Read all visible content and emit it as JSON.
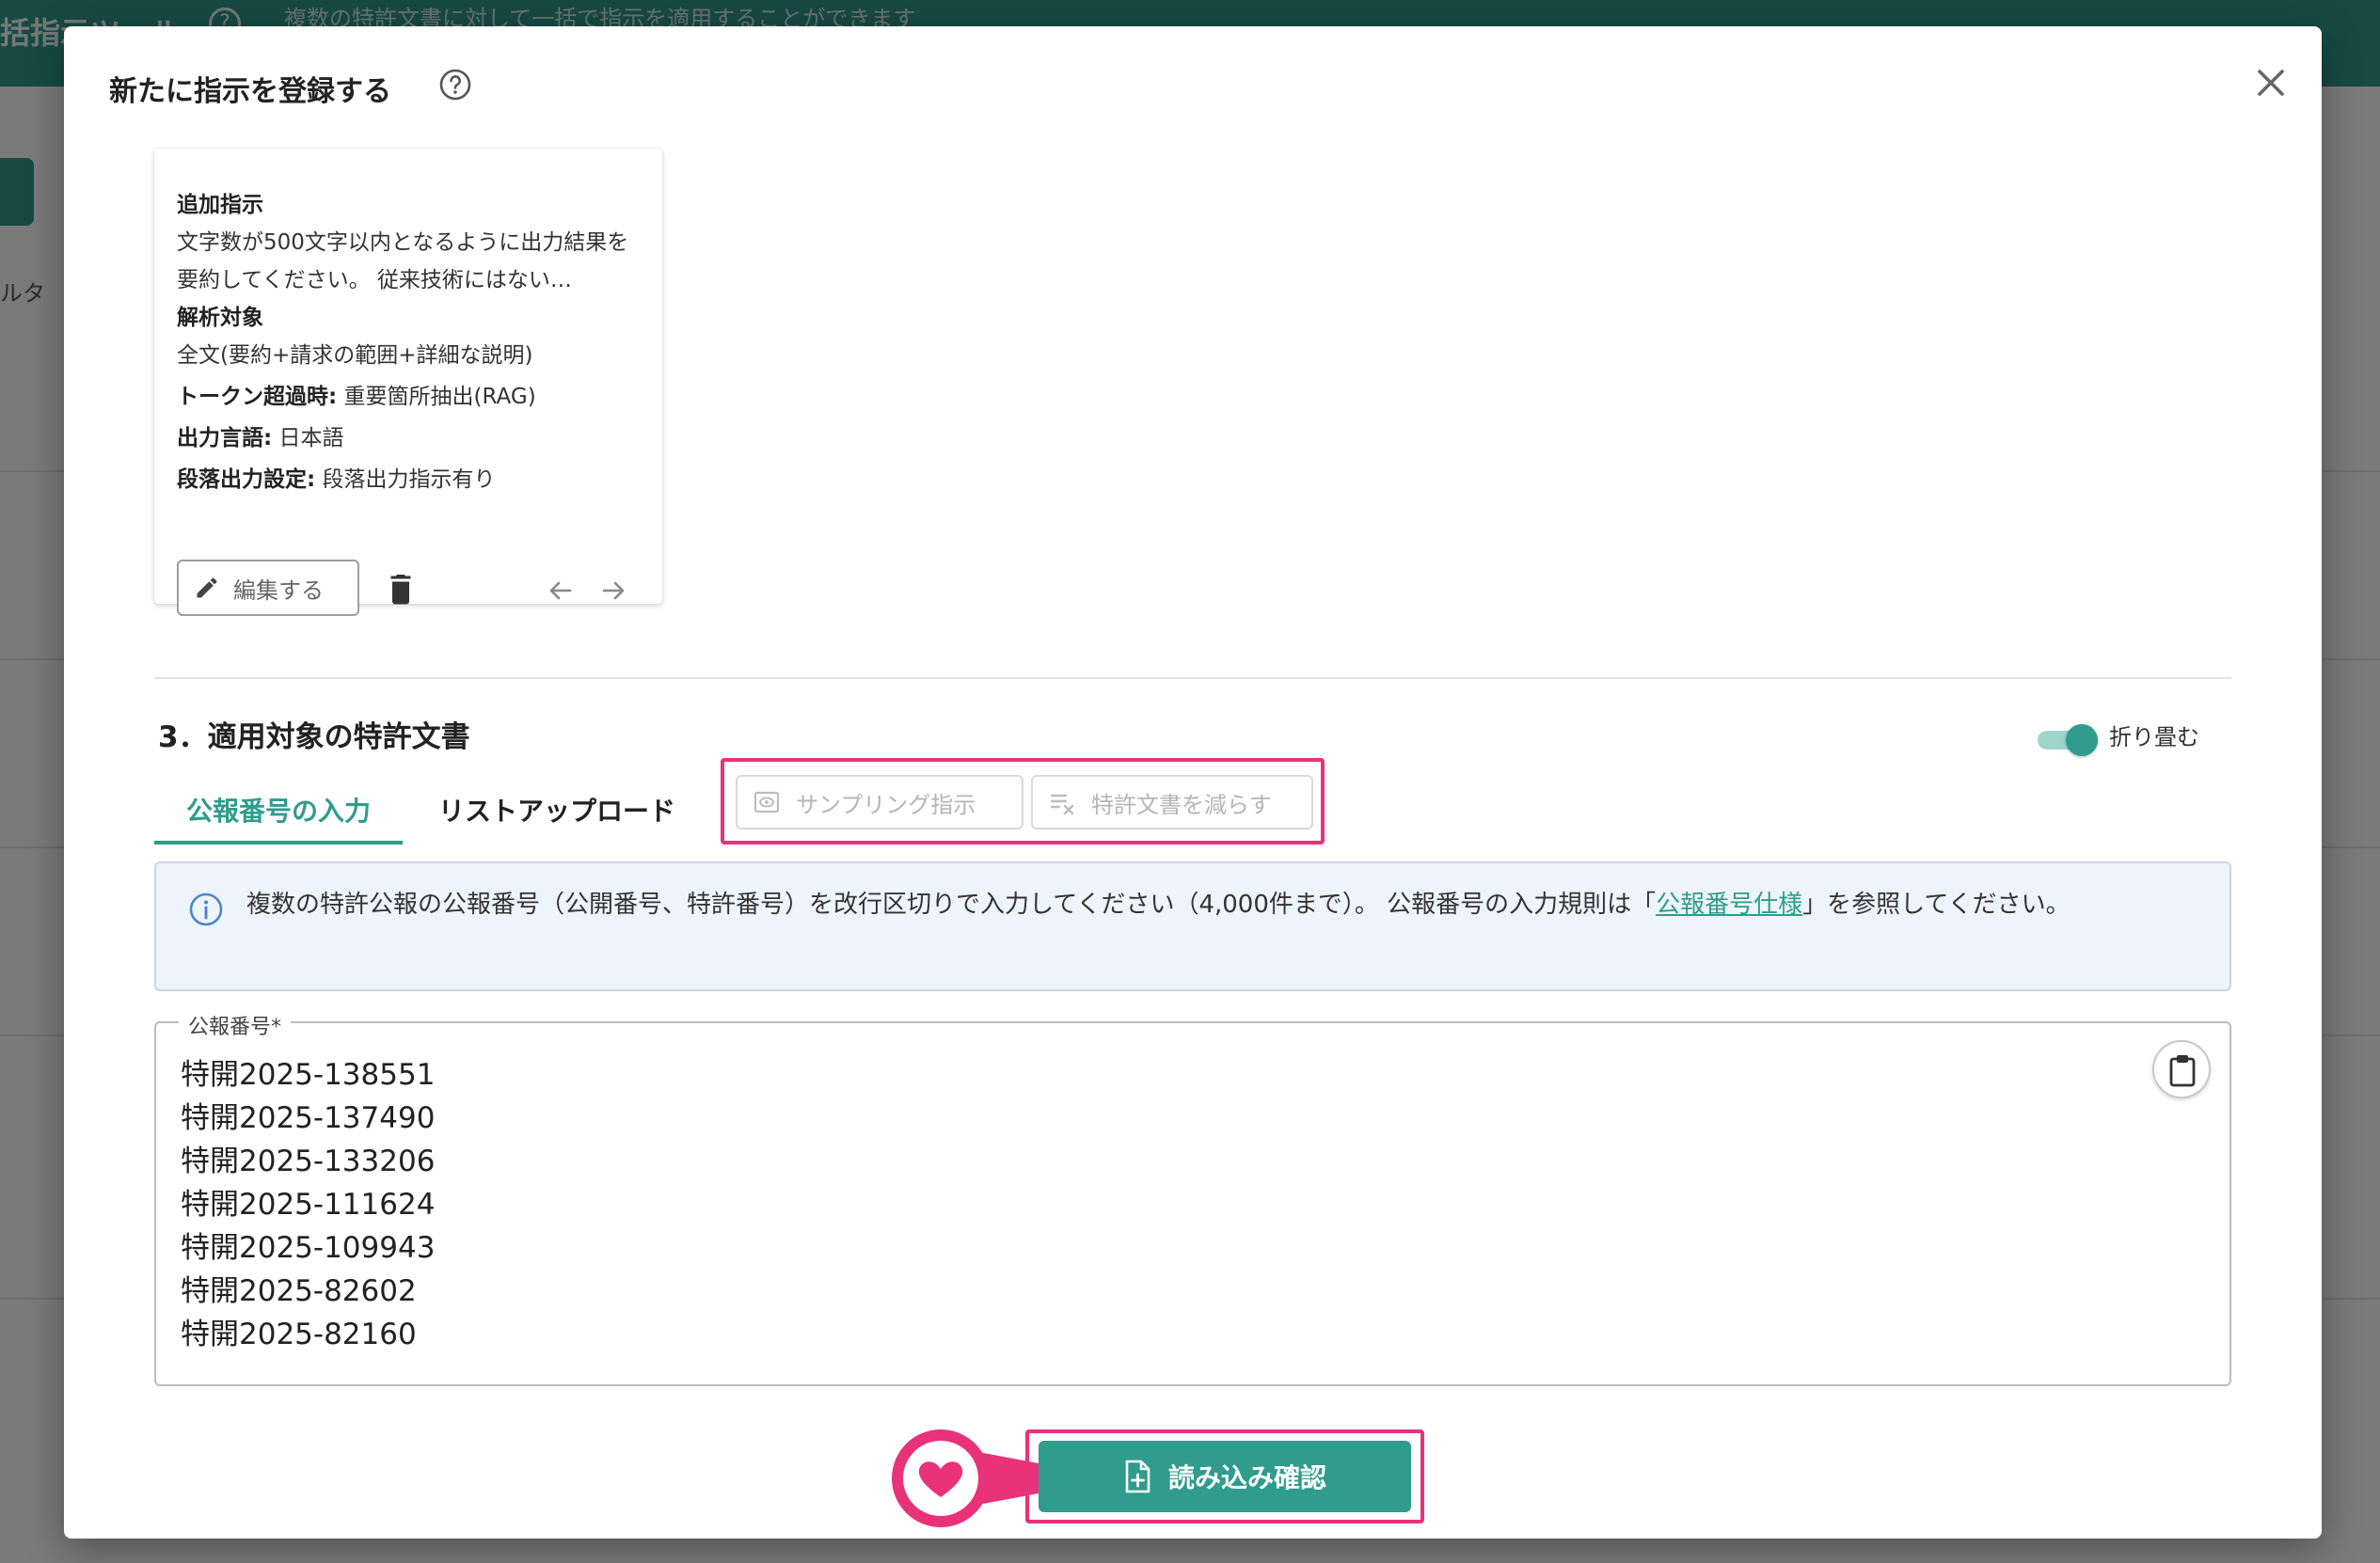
{
  "background": {
    "header_title": "括指示ツール",
    "header_subtitle": "複数の特許文書に対して一括で指示を適用することができます",
    "filter_label": "ルタ"
  },
  "dialog": {
    "title": "新たに指示を登録する",
    "close_icon": "close-icon",
    "help_icon": "help-circle-icon"
  },
  "card": {
    "additional_label": "追加指示",
    "additional_text": "文字数が500文字以内となるように出力結果を要約してください。 従来技術にはない…",
    "target_label": "解析対象",
    "target_value": "全文(要約+請求の範囲+詳細な説明)",
    "token_label": "トークン超過時:",
    "token_value": "重要箇所抽出(RAG)",
    "lang_label": "出力言語:",
    "lang_value": "日本語",
    "para_label": "段落出力設定:",
    "para_value": "段落出力指示有り",
    "edit_label": "編集する"
  },
  "section3": {
    "title": "3．適用対象の特許文書",
    "toggle_label": "折り畳む",
    "toggle_on": true,
    "tabs": [
      {
        "label": "公報番号の入力",
        "active": true
      },
      {
        "label": "リストアップロード",
        "active": false
      }
    ],
    "sampling_label": "サンプリング指示",
    "reduce_label": "特許文書を減らす",
    "info_text_before": "複数の特許公報の公報番号（公開番号、特許番号）を改行区切りで入力してください（4,000件まで）。 公報番号の入力規則は「",
    "info_link": "公報番号仕様",
    "info_text_after": "」を参照してください。",
    "field_label": "公報番号*",
    "numbers": [
      "特開2025-138551",
      "特開2025-137490",
      "特開2025-133206",
      "特開2025-111624",
      "特開2025-109943",
      "特開2025-82602",
      "特開2025-82160"
    ]
  },
  "footer": {
    "confirm_label": "読み込み確認"
  },
  "colors": {
    "accent": "#2f9c8d",
    "highlight": "#e8327a",
    "info_bg": "#eef4fb"
  }
}
